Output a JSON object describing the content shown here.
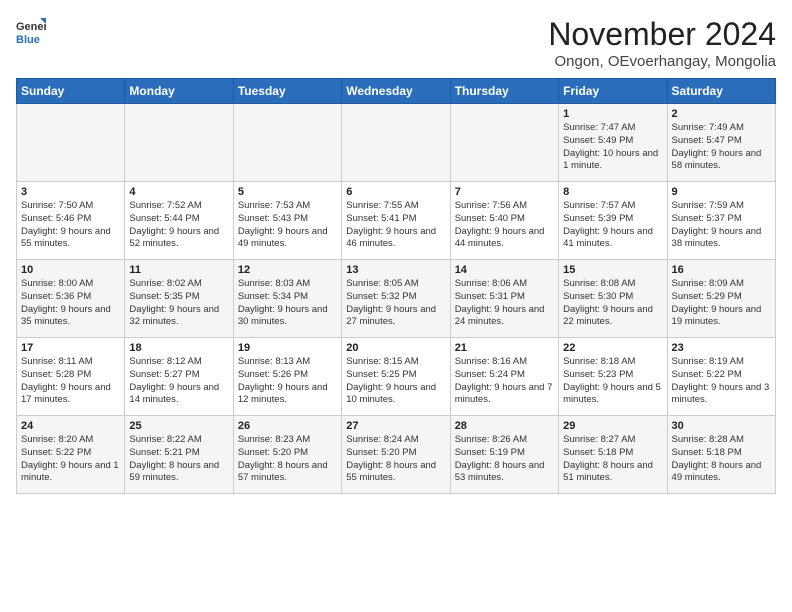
{
  "header": {
    "logo_line1": "General",
    "logo_line2": "Blue",
    "month_title": "November 2024",
    "subtitle": "Ongon, OEvoerhangay, Mongolia"
  },
  "weekdays": [
    "Sunday",
    "Monday",
    "Tuesday",
    "Wednesday",
    "Thursday",
    "Friday",
    "Saturday"
  ],
  "weeks": [
    [
      {
        "day": "",
        "info": ""
      },
      {
        "day": "",
        "info": ""
      },
      {
        "day": "",
        "info": ""
      },
      {
        "day": "",
        "info": ""
      },
      {
        "day": "",
        "info": ""
      },
      {
        "day": "1",
        "info": "Sunrise: 7:47 AM\nSunset: 5:49 PM\nDaylight: 10 hours and 1 minute."
      },
      {
        "day": "2",
        "info": "Sunrise: 7:49 AM\nSunset: 5:47 PM\nDaylight: 9 hours and 58 minutes."
      }
    ],
    [
      {
        "day": "3",
        "info": "Sunrise: 7:50 AM\nSunset: 5:46 PM\nDaylight: 9 hours and 55 minutes."
      },
      {
        "day": "4",
        "info": "Sunrise: 7:52 AM\nSunset: 5:44 PM\nDaylight: 9 hours and 52 minutes."
      },
      {
        "day": "5",
        "info": "Sunrise: 7:53 AM\nSunset: 5:43 PM\nDaylight: 9 hours and 49 minutes."
      },
      {
        "day": "6",
        "info": "Sunrise: 7:55 AM\nSunset: 5:41 PM\nDaylight: 9 hours and 46 minutes."
      },
      {
        "day": "7",
        "info": "Sunrise: 7:56 AM\nSunset: 5:40 PM\nDaylight: 9 hours and 44 minutes."
      },
      {
        "day": "8",
        "info": "Sunrise: 7:57 AM\nSunset: 5:39 PM\nDaylight: 9 hours and 41 minutes."
      },
      {
        "day": "9",
        "info": "Sunrise: 7:59 AM\nSunset: 5:37 PM\nDaylight: 9 hours and 38 minutes."
      }
    ],
    [
      {
        "day": "10",
        "info": "Sunrise: 8:00 AM\nSunset: 5:36 PM\nDaylight: 9 hours and 35 minutes."
      },
      {
        "day": "11",
        "info": "Sunrise: 8:02 AM\nSunset: 5:35 PM\nDaylight: 9 hours and 32 minutes."
      },
      {
        "day": "12",
        "info": "Sunrise: 8:03 AM\nSunset: 5:34 PM\nDaylight: 9 hours and 30 minutes."
      },
      {
        "day": "13",
        "info": "Sunrise: 8:05 AM\nSunset: 5:32 PM\nDaylight: 9 hours and 27 minutes."
      },
      {
        "day": "14",
        "info": "Sunrise: 8:06 AM\nSunset: 5:31 PM\nDaylight: 9 hours and 24 minutes."
      },
      {
        "day": "15",
        "info": "Sunrise: 8:08 AM\nSunset: 5:30 PM\nDaylight: 9 hours and 22 minutes."
      },
      {
        "day": "16",
        "info": "Sunrise: 8:09 AM\nSunset: 5:29 PM\nDaylight: 9 hours and 19 minutes."
      }
    ],
    [
      {
        "day": "17",
        "info": "Sunrise: 8:11 AM\nSunset: 5:28 PM\nDaylight: 9 hours and 17 minutes."
      },
      {
        "day": "18",
        "info": "Sunrise: 8:12 AM\nSunset: 5:27 PM\nDaylight: 9 hours and 14 minutes."
      },
      {
        "day": "19",
        "info": "Sunrise: 8:13 AM\nSunset: 5:26 PM\nDaylight: 9 hours and 12 minutes."
      },
      {
        "day": "20",
        "info": "Sunrise: 8:15 AM\nSunset: 5:25 PM\nDaylight: 9 hours and 10 minutes."
      },
      {
        "day": "21",
        "info": "Sunrise: 8:16 AM\nSunset: 5:24 PM\nDaylight: 9 hours and 7 minutes."
      },
      {
        "day": "22",
        "info": "Sunrise: 8:18 AM\nSunset: 5:23 PM\nDaylight: 9 hours and 5 minutes."
      },
      {
        "day": "23",
        "info": "Sunrise: 8:19 AM\nSunset: 5:22 PM\nDaylight: 9 hours and 3 minutes."
      }
    ],
    [
      {
        "day": "24",
        "info": "Sunrise: 8:20 AM\nSunset: 5:22 PM\nDaylight: 9 hours and 1 minute."
      },
      {
        "day": "25",
        "info": "Sunrise: 8:22 AM\nSunset: 5:21 PM\nDaylight: 8 hours and 59 minutes."
      },
      {
        "day": "26",
        "info": "Sunrise: 8:23 AM\nSunset: 5:20 PM\nDaylight: 8 hours and 57 minutes."
      },
      {
        "day": "27",
        "info": "Sunrise: 8:24 AM\nSunset: 5:20 PM\nDaylight: 8 hours and 55 minutes."
      },
      {
        "day": "28",
        "info": "Sunrise: 8:26 AM\nSunset: 5:19 PM\nDaylight: 8 hours and 53 minutes."
      },
      {
        "day": "29",
        "info": "Sunrise: 8:27 AM\nSunset: 5:18 PM\nDaylight: 8 hours and 51 minutes."
      },
      {
        "day": "30",
        "info": "Sunrise: 8:28 AM\nSunset: 5:18 PM\nDaylight: 8 hours and 49 minutes."
      }
    ]
  ]
}
